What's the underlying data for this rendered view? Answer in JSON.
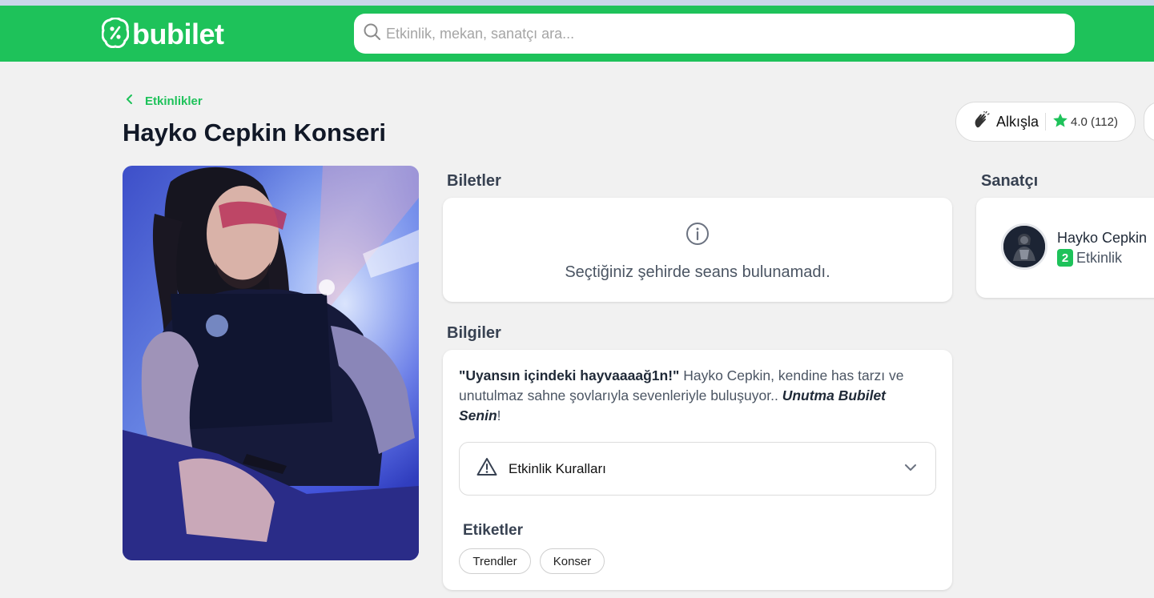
{
  "header": {
    "logo_text": "bubilet",
    "search_placeholder": "Etkinlik, mekan, sanatçı ara..."
  },
  "breadcrumb": {
    "label": "Etkinlikler"
  },
  "event": {
    "title": "Hayko Cepkin Konseri",
    "clap_label": "Alkışla",
    "rating_text": "4.0 (112)"
  },
  "tickets": {
    "section_title": "Biletler",
    "empty_message": "Seçtiğiniz şehirde seans bulunamadı."
  },
  "info": {
    "section_title": "Bilgiler",
    "quote_open": "\"",
    "quote_bold": "Uyansın içindeki hayvaaaağ1n!\"",
    "desc_text": " Hayko Cepkin, kendine has tarzı ve unutulmaz sahne şovlarıyla sevenleriyle buluşuyor.. ",
    "desc_emph": "Unutma Bubilet Senin",
    "desc_end": "!",
    "rules_label": "Etkinlik Kuralları",
    "tags_title": "Etiketler",
    "tags": [
      "Trendler",
      "Konser"
    ]
  },
  "artist": {
    "section_title": "Sanatçı",
    "name": "Hayko Cepkin",
    "event_count": "2",
    "event_label": "Etkinlik"
  },
  "colors": {
    "brand_green": "#1ec25a",
    "background": "#f1f1f1"
  },
  "icons": {
    "logo": "ticket-logo-icon",
    "search": "search-icon",
    "back": "chevron-left-icon",
    "clap": "clap-icon",
    "rating": "star-icon",
    "info": "info-icon",
    "warning": "warning-icon",
    "expand": "chevron-down-icon"
  }
}
